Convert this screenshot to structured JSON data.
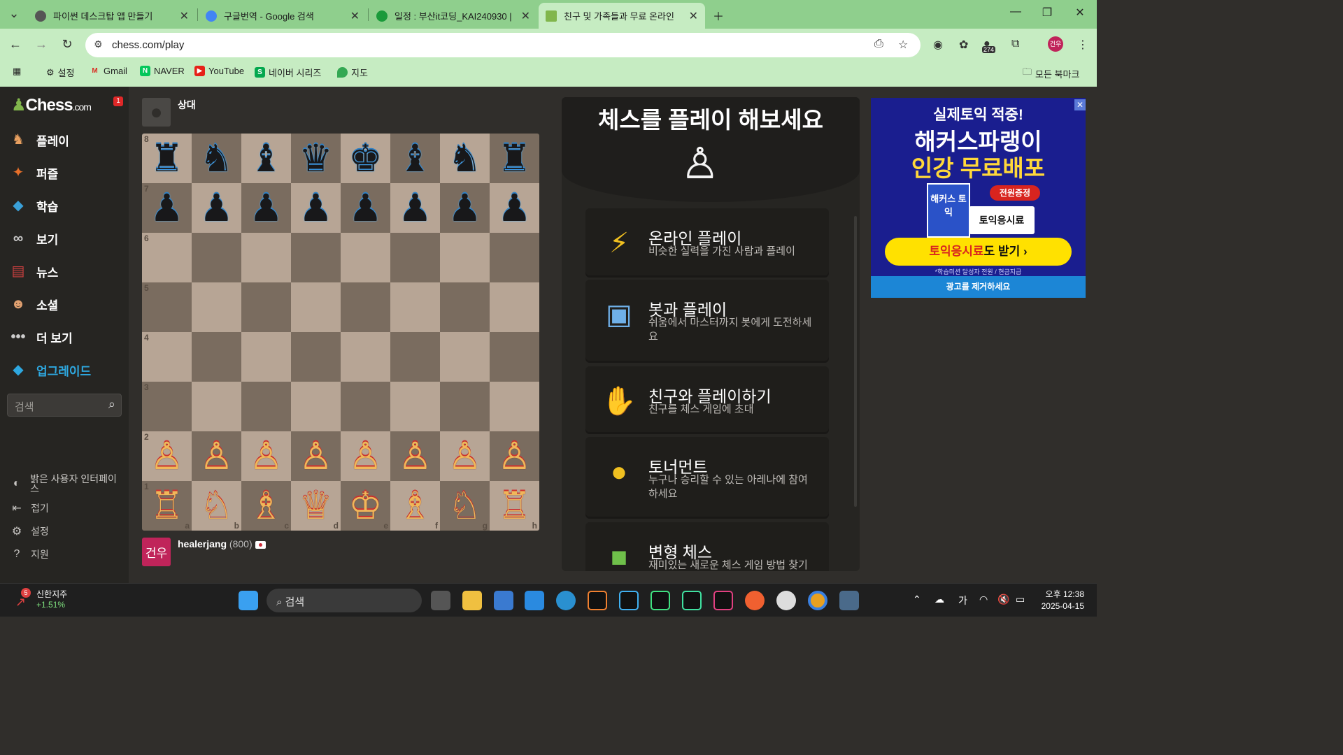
{
  "browser": {
    "tabs": [
      {
        "title": "파이썬 데스크탑 앱 만들기",
        "color": "#555555"
      },
      {
        "title": "구글번역 - Google 검색",
        "color": "#4285f4"
      },
      {
        "title": "일정 : 부산it코딩_KAI240930 | ",
        "color": "#1a9a3a"
      },
      {
        "title": "친구 및 가족들과 무료 온라인",
        "color": "#81b64c"
      }
    ],
    "url": "chess.com/play",
    "extension_badge": "274",
    "profile_initials": "건우",
    "bookmarks": [
      "설정",
      "Gmail",
      "NAVER",
      "YouTube",
      "네이버 시리즈",
      "지도"
    ],
    "all_bookmarks": "모든 북마크"
  },
  "sidebar": {
    "logo_name": "Chess",
    "logo_domain": ".com",
    "notification_count": "1",
    "items": [
      {
        "label": "플레이",
        "icon": "play-icon",
        "color": "#e8a060"
      },
      {
        "label": "퍼즐",
        "icon": "puzzle-icon",
        "color": "#e8702a"
      },
      {
        "label": "학습",
        "icon": "learn-icon",
        "color": "#3aa0d8"
      },
      {
        "label": "보기",
        "icon": "watch-icon",
        "color": "#cccccc"
      },
      {
        "label": "뉴스",
        "icon": "news-icon",
        "color": "#d04040"
      },
      {
        "label": "소셜",
        "icon": "social-icon",
        "color": "#e0a070"
      },
      {
        "label": "더 보기",
        "icon": "more-icon",
        "color": "#cccccc"
      }
    ],
    "upgrade_label": "업그레이드",
    "upgrade_color": "#2ea8e0",
    "search_placeholder": "검색",
    "bottom": [
      "밝은 사용자 인터페이스",
      "접기",
      "설정",
      "지원"
    ]
  },
  "game": {
    "opponent": "상대",
    "player_name": "healerjang",
    "player_rating": "(800)",
    "player_avatar_text": "건우",
    "player_avatar_color": "#c0245a",
    "ranks": [
      "8",
      "7",
      "6",
      "5",
      "4",
      "3",
      "2",
      "1"
    ],
    "files": [
      "a",
      "b",
      "c",
      "d",
      "e",
      "f",
      "g",
      "h"
    ],
    "position": [
      [
        "♜",
        "♞",
        "♝",
        "♛",
        "♚",
        "♝",
        "♞",
        "♜"
      ],
      [
        "♟",
        "♟",
        "♟",
        "♟",
        "♟",
        "♟",
        "♟",
        "♟"
      ],
      [
        "",
        "",
        "",
        "",
        "",
        "",
        "",
        ""
      ],
      [
        "",
        "",
        "",
        "",
        "",
        "",
        "",
        ""
      ],
      [
        "",
        "",
        "",
        "",
        "",
        "",
        "",
        ""
      ],
      [
        "",
        "",
        "",
        "",
        "",
        "",
        "",
        ""
      ],
      [
        "♙",
        "♙",
        "♙",
        "♙",
        "♙",
        "♙",
        "♙",
        "♙"
      ],
      [
        "♖",
        "♘",
        "♗",
        "♕",
        "♔",
        "♗",
        "♘",
        "♖"
      ]
    ]
  },
  "play_panel": {
    "title": "체스를 플레이 해보세요",
    "options": [
      {
        "title": "온라인 플레이",
        "subtitle": "비슷한 실력을 가진 사람과 플레이",
        "icon": "lightning-icon",
        "glyph": "⚡"
      },
      {
        "title": "봇과 플레이",
        "subtitle": "쉬움에서 마스터까지 봇에게 도전하세요",
        "icon": "bot-icon",
        "glyph": "🤖"
      },
      {
        "title": "친구와 플레이하기",
        "subtitle": "친구를 체스 게임에 초대",
        "icon": "handshake-icon",
        "glyph": "🤝"
      },
      {
        "title": "토너먼트",
        "subtitle": "누구나 승리할 수 있는 아레나에 참여하세요",
        "icon": "medal-icon",
        "glyph": "🏅"
      },
      {
        "title": "변형 체스",
        "subtitle": "재미있는 새로운 체스 게임 방법 찾기",
        "icon": "variants-icon",
        "glyph": "🎲"
      }
    ]
  },
  "ad": {
    "line1": "실제토익 적중!",
    "line2": "해커스파랭이",
    "line3": "인강 무료배포",
    "book": "해커스 토익",
    "gift": "전원증정",
    "free": "토익응시료",
    "cta_red": "토익응시료",
    "cta_rest": "도 받기 ›",
    "fine": "*학습미션 달성자 전원 / 현금지급",
    "remove": "광고를 제거하세요"
  },
  "taskbar": {
    "stock_name": "신한지주",
    "stock_change": "+1.51%",
    "stock_badge": "5",
    "search": "검색",
    "ime": "가",
    "time": "오후 12:38",
    "date": "2025-04-15"
  }
}
